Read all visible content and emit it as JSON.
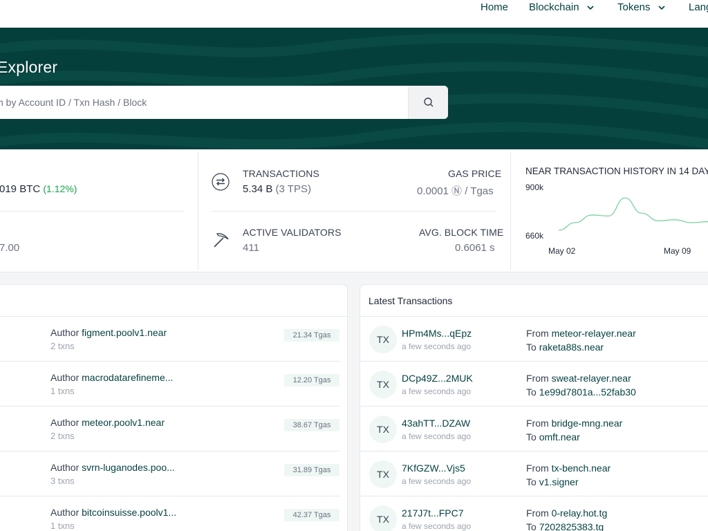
{
  "nav": {
    "home": "Home",
    "blockchain": "Blockchain",
    "tokens": "Tokens",
    "languages": "Lang"
  },
  "hero": {
    "title": "Explorer",
    "search_placeholder": "ch by Account ID / Txn Hash / Block"
  },
  "stats": {
    "price_btc": "019 BTC",
    "price_change": "(1.12%)",
    "market_cap_partial": "7.00",
    "transactions_label": "TRANSACTIONS",
    "transactions_value": "5.34 B",
    "tps": "(3 TPS)",
    "gas_price_label": "GAS PRICE",
    "gas_price_value": "0.0001 Ⓝ / Tgas",
    "validators_label": "ACTIVE VALIDATORS",
    "validators_value": "411",
    "block_time_label": "AVG. BLOCK TIME",
    "block_time_value": "0.6061 s"
  },
  "chart_data": {
    "type": "line",
    "title": "NEAR TRANSACTION HISTORY IN 14 DAYS",
    "y_ticks": [
      "900k",
      "660k"
    ],
    "x_ticks": [
      "May 02",
      "May 09"
    ],
    "ylim": [
      660000,
      900000
    ],
    "series": [
      {
        "x": [
          0,
          1,
          2,
          3,
          4,
          5,
          6,
          7,
          8,
          9
        ],
        "values": [
          700000,
          740000,
          780000,
          775000,
          870000,
          790000,
          750000,
          755000,
          740000,
          745000
        ]
      }
    ],
    "grid": false,
    "line_color": "#6fcf97"
  },
  "blocks": {
    "rows": [
      {
        "author_prefix": "Author ",
        "author": "figment.poolv1.near",
        "txns": "2 txns",
        "gas": "21.34 Tgas"
      },
      {
        "author_prefix": "Author ",
        "author": "macrodatarefineme...",
        "txns": "1 txns",
        "gas": "12.20 Tgas"
      },
      {
        "author_prefix": "Author ",
        "author": "meteor.poolv1.near",
        "txns": "2 txns",
        "gas": "38.67 Tgas"
      },
      {
        "author_prefix": "Author ",
        "author": "svrn-luganodes.poo...",
        "txns": "3 txns",
        "gas": "31.89 Tgas"
      },
      {
        "author_prefix": "Author ",
        "author": "bitcoinsuisse.poolv1...",
        "txns": "1 txns",
        "gas": "42.37 Tgas"
      }
    ]
  },
  "transactions": {
    "title": "Latest Transactions",
    "rows": [
      {
        "badge": "TX",
        "hash": "HPm4Ms...qEpz",
        "age": "a few seconds ago",
        "from_prefix": "From ",
        "from": "meteor-relayer.near",
        "to_prefix": "To ",
        "to": "raketa88s.near"
      },
      {
        "badge": "TX",
        "hash": "DCp49Z...2MUK",
        "age": "a few seconds ago",
        "from_prefix": "From ",
        "from": "sweat-relayer.near",
        "to_prefix": "To ",
        "to": "1e99d7801a...52fab30"
      },
      {
        "badge": "TX",
        "hash": "43ahTT...DZAW",
        "age": "a few seconds ago",
        "from_prefix": "From ",
        "from": "bridge-mng.near",
        "to_prefix": "To ",
        "to": "omft.near"
      },
      {
        "badge": "TX",
        "hash": "7KfGZW...Vjs5",
        "age": "a few seconds ago",
        "from_prefix": "From ",
        "from": "tx-bench.near",
        "to_prefix": "To ",
        "to": "v1.signer"
      },
      {
        "badge": "TX",
        "hash": "217J7t...FPC7",
        "age": "a few seconds ago",
        "from_prefix": "From ",
        "from": "0-relay.hot.tg",
        "to_prefix": "To ",
        "to": "7202825383.tg"
      }
    ]
  }
}
